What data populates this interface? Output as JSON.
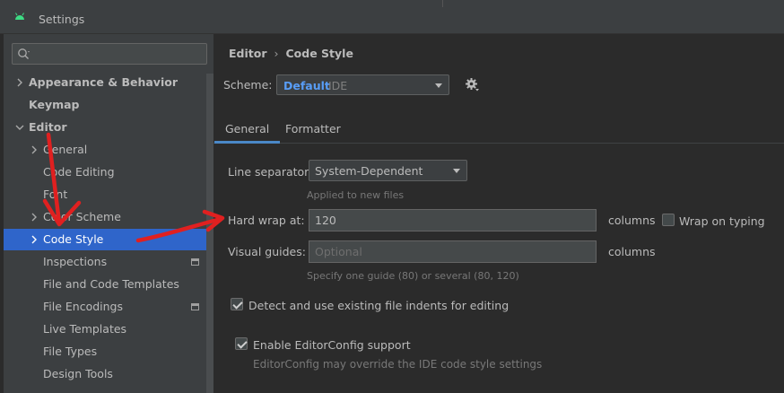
{
  "window": {
    "title": "Settings",
    "icon": "android-icon"
  },
  "search": {
    "placeholder": "",
    "icon": "search-icon"
  },
  "sidebar": {
    "items": [
      {
        "label": "Appearance & Behavior",
        "expander": "right"
      },
      {
        "label": "Keymap",
        "expander": "none"
      },
      {
        "label": "Editor",
        "expander": "down"
      },
      {
        "label": "General",
        "expander": "right"
      },
      {
        "label": "Code Editing",
        "expander": "none"
      },
      {
        "label": "Font",
        "expander": "none"
      },
      {
        "label": "Color Scheme",
        "expander": "right"
      },
      {
        "label": "Code Style",
        "expander": "right",
        "selected": true
      },
      {
        "label": "Inspections",
        "expander": "none",
        "project_icon": true
      },
      {
        "label": "File and Code Templates",
        "expander": "none"
      },
      {
        "label": "File Encodings",
        "expander": "none",
        "project_icon": true
      },
      {
        "label": "Live Templates",
        "expander": "none"
      },
      {
        "label": "File Types",
        "expander": "none"
      },
      {
        "label": "Design Tools",
        "expander": "none"
      }
    ]
  },
  "breadcrumb": {
    "parent": "Editor",
    "current": "Code Style"
  },
  "scheme": {
    "label": "Scheme:",
    "value": "Default",
    "sub": "IDE"
  },
  "tabs": [
    {
      "label": "General",
      "active": true
    },
    {
      "label": "Formatter",
      "active": false
    }
  ],
  "general": {
    "line_separator": {
      "label": "Line separator:",
      "value": "System-Dependent",
      "hint": "Applied to new files"
    },
    "hard_wrap": {
      "label": "Hard wrap at:",
      "value": "120",
      "unit": "columns"
    },
    "wrap_on_typing": {
      "label": "Wrap on typing",
      "checked": false
    },
    "visual_guides": {
      "label": "Visual guides:",
      "placeholder": "Optional",
      "unit": "columns",
      "hint": "Specify one guide (80) or several (80, 120)"
    },
    "detect_indents": {
      "label": "Detect and use existing file indents for editing",
      "checked": true
    },
    "editorconfig": {
      "label": "Enable EditorConfig support",
      "checked": true,
      "hint": "EditorConfig may override the IDE code style settings"
    }
  },
  "colors": {
    "selection": "#2f65ca",
    "accent": "#589df6",
    "annotation": "#e02020"
  }
}
